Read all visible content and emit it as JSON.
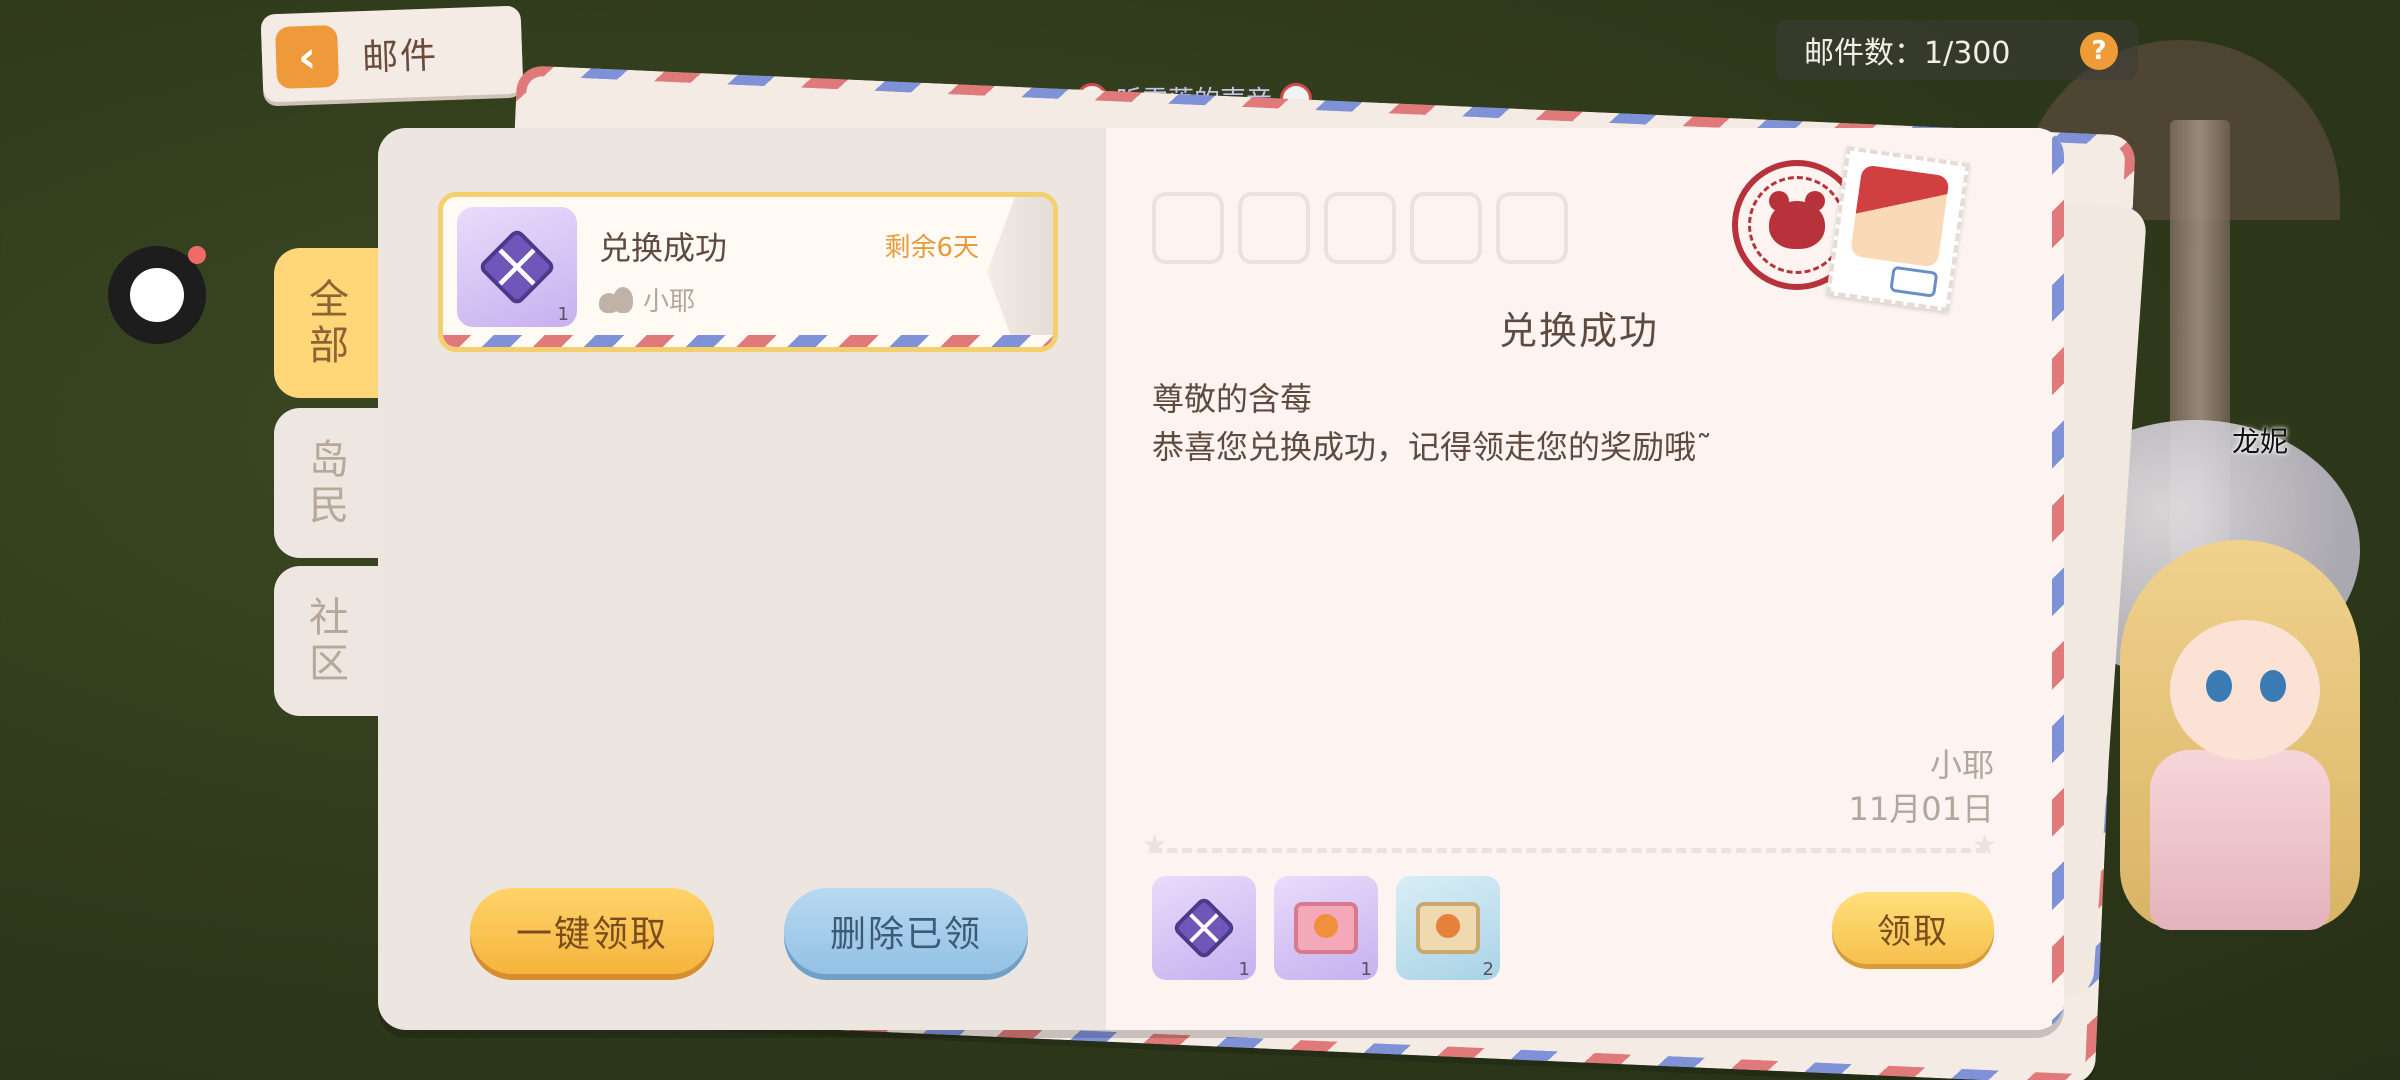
{
  "header": {
    "title": "邮件",
    "back_icon": "chevron-left-icon",
    "mail_count_label": "邮件数：1/300",
    "help_label": "?"
  },
  "scene": {
    "player_name": "听雪落的声音",
    "npc_name": "龙妮"
  },
  "tabs": [
    {
      "chars": [
        "全",
        "部"
      ],
      "active": true
    },
    {
      "chars": [
        "岛",
        "民"
      ],
      "active": false
    },
    {
      "chars": [
        "社",
        "区"
      ],
      "active": false
    }
  ],
  "mail_list": [
    {
      "title": "兑换成功",
      "remaining": "剩余6天",
      "sender": "小耶",
      "item_qty": "1",
      "selected": true
    }
  ],
  "list_actions": {
    "claim_all": "一键领取",
    "delete_claimed": "删除已领"
  },
  "detail": {
    "title": "兑换成功",
    "greeting": "尊敬的含莓",
    "body": "恭喜您兑换成功，记得领走您的奖励哦˜",
    "sender": "小耶",
    "date": "11月01日",
    "rewards": [
      {
        "icon": "purple-diamond-icon",
        "qty": "1"
      },
      {
        "icon": "pink-box-icon",
        "qty": "1"
      },
      {
        "icon": "tan-box-icon",
        "qty": "2"
      }
    ],
    "claim_label": "领取"
  },
  "colors": {
    "accent_yellow": "#ffd779",
    "claim_orange": "#f6b43d",
    "delete_blue": "#93c1e5",
    "remaining_orange": "#e89b3c",
    "postmark_red": "#b7323a"
  }
}
